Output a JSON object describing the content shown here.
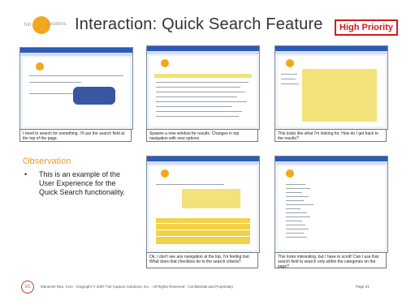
{
  "slide": {
    "title": "Interaction: Quick Search Feature",
    "priority_label": "High Priority",
    "logo_text": "solutions"
  },
  "screenshots": [
    {
      "caption": "I need to search for something. I'll use the search field at the top of the page."
    },
    {
      "caption": "Spawns a new window for results. Changes in top navigation with new options."
    },
    {
      "caption": "This looks like what I'm looking for. How do I get back to the results?"
    },
    {
      "caption": "Ok, I don't see any navigation at the top, I'm feeling lost. What does that checkbox do to the search criteria?"
    },
    {
      "caption": "This looks interesting, but I have to scroll! Can I use that search field to search only within the categories on the page?"
    }
  ],
  "observation": {
    "heading": "Observation",
    "bullet": "This is an example of the User Experience for the Quick Search functionality."
  },
  "footer": {
    "badge": "1/1",
    "text": "Maneesh Rao, CUA - Copyright © 2007 Full Capture Solutions, Inc. - All Rights Reserved - Confidential and Proprietary",
    "page": "Page 21"
  },
  "colors": {
    "accent_orange": "#f29a1c",
    "priority_red": "#d21a1a",
    "window_blue": "#2c5bb8"
  }
}
